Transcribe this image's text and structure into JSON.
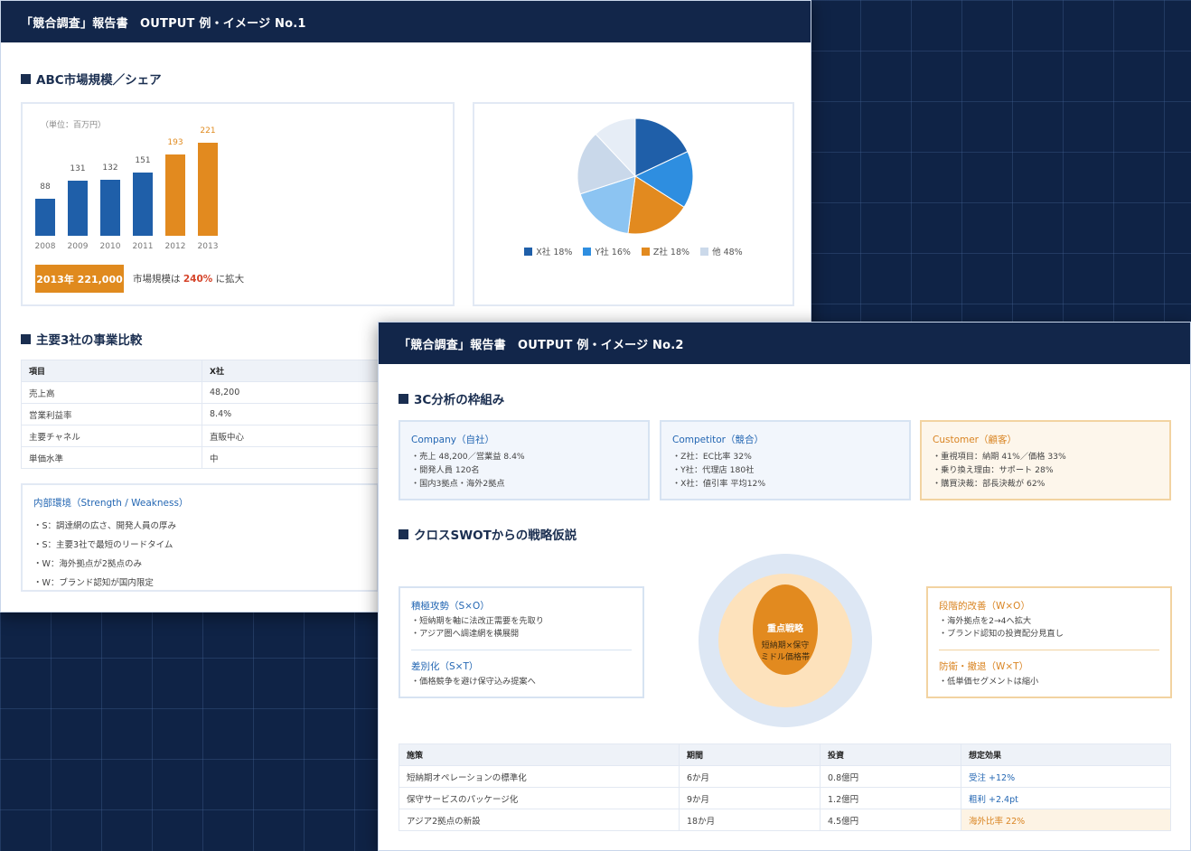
{
  "doc1": {
    "header": "「競合調査」報告書　OUTPUT 例・イメージ No.1",
    "section1_title": "ABC市場規模／シェア",
    "bar_chart": {
      "unit": "（単位：百万円）",
      "highlight_label": "2013年 221,000",
      "growth_prefix": "市場規模は",
      "growth_pct": "240%",
      "growth_suffix": "に拡大"
    },
    "section2_title": "主要3社の事業比較",
    "table": {
      "headers": [
        "項目",
        "X社"
      ],
      "rows": [
        [
          "売上高",
          "48,200"
        ],
        [
          "営業利益率",
          "8.4%"
        ],
        [
          "主要チャネル",
          "直販中心"
        ],
        [
          "単価水準",
          "中"
        ]
      ]
    },
    "internal": {
      "title": "内部環境（Strength / Weakness）",
      "items": [
        "・S：調達網の広さ、開発人員の厚み",
        "・S：主要3社で最短のリードタイム",
        "・W：海外拠点が2拠点のみ",
        "・W：ブランド認知が国内限定"
      ]
    }
  },
  "chart_data": [
    {
      "type": "bar",
      "title": "",
      "categories": [
        "2008",
        "2009",
        "2010",
        "2011",
        "2012",
        "2013"
      ],
      "values": [
        88,
        131,
        132,
        151,
        193,
        221
      ],
      "colors": [
        "#1f5fa9",
        "#1f5fa9",
        "#1f5fa9",
        "#1f5fa9",
        "#e28a1f",
        "#e28a1f"
      ],
      "ylim": [
        0,
        240
      ],
      "xlabel": "",
      "ylabel": ""
    },
    {
      "type": "pie",
      "title": "",
      "slices": [
        {
          "label": "X社 18%",
          "value": 18,
          "color": "#1f5fa9"
        },
        {
          "label": "Y社 16%",
          "value": 16,
          "color": "#2e8ee0"
        },
        {
          "label": "Z社 18%",
          "value": 18,
          "color": "#e28a1f"
        },
        {
          "label": "他 48%",
          "value": 48,
          "color": "#cbd9ea",
          "sub_colors": [
            "#8cc4f2",
            "#c9d8ea",
            "#e6edf6"
          ],
          "sub_values": [
            18,
            18,
            12
          ]
        }
      ]
    }
  ],
  "doc2": {
    "header": "「競合調査」報告書　OUTPUT 例・イメージ No.2",
    "section1_title": "3C分析の枠組み",
    "company": {
      "title": "Company（自社）",
      "items": [
        "・売上 48,200／営業益 8.4%",
        "・開発人員 120名",
        "・国内3拠点・海外2拠点"
      ]
    },
    "competitor": {
      "title": "Competitor（競合）",
      "items": [
        "・Z社：EC比率 32%",
        "・Y社：代理店 180社",
        "・X社：値引率 平均12%"
      ]
    },
    "customer": {
      "title": "Customer（顧客）",
      "items": [
        "・重視項目：納期 41%／価格 33%",
        "・乗り換え理由：サポート 28%",
        "・購買決裁：部長決裁が 62%"
      ]
    },
    "section2_title": "クロスSWOTからの戦略仮説",
    "so": {
      "title": "積極攻勢（S×O）",
      "items": [
        "・短納期を軸に法改正需要を先取り",
        "・アジア圏へ調達網を横展開"
      ]
    },
    "st": {
      "title": "差別化（S×T）",
      "items": [
        "・価格競争を避け保守込み提案へ"
      ]
    },
    "wo": {
      "title": "段階的改善（W×O）",
      "items": [
        "・海外拠点を2→4へ拡大",
        "・ブランド認知の投資配分見直し"
      ]
    },
    "wt": {
      "title": "防衛・撤退（W×T）",
      "items": [
        "・低単価セグメントは縮小"
      ]
    },
    "core": {
      "title": "重点戦略",
      "line1": "短納期×保守",
      "line2": "ミドル価格帯"
    },
    "table": {
      "headers": [
        "施策",
        "期間",
        "投資",
        "想定効果"
      ],
      "rows": [
        [
          "短納期オペレーションの標準化",
          "6か月",
          "0.8億円",
          "受注 +12%"
        ],
        [
          "保守サービスのパッケージ化",
          "9か月",
          "1.2億円",
          "粗利 +2.4pt"
        ],
        [
          "アジア2拠点の新設",
          "18か月",
          "4.5億円",
          "海外比率 22%"
        ]
      ]
    }
  }
}
